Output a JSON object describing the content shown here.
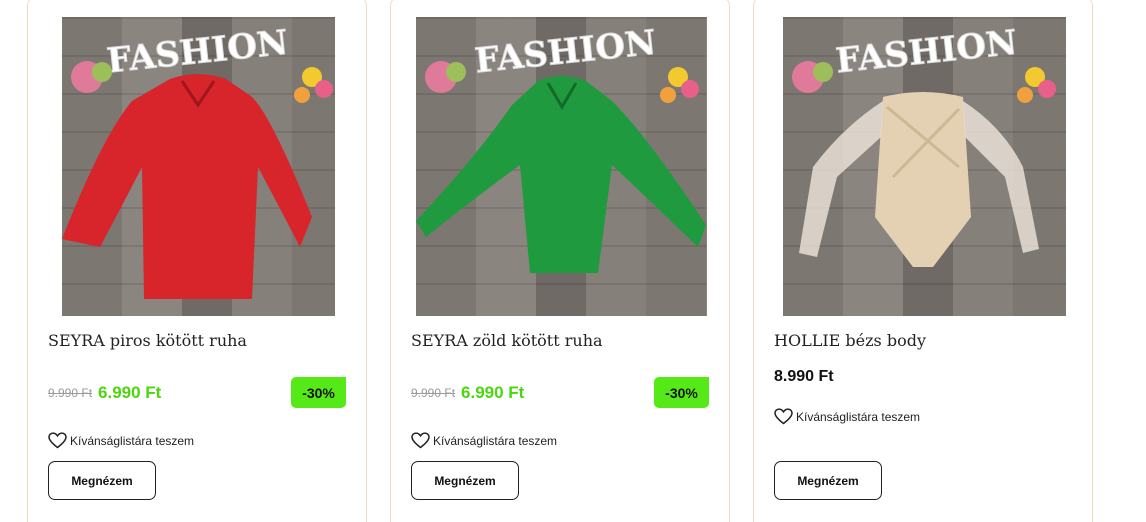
{
  "products": [
    {
      "name": "SEYRA piros kötött ruha",
      "old_price": "9.990 Ft",
      "price": "6.990 Ft",
      "discount": "-30%",
      "wishlist_label": "Kívánságlistára teszem",
      "button_label": "Megnézem",
      "photo_sign": "FASHION",
      "garment_color": "#d8242b"
    },
    {
      "name": "SEYRA zöld kötött ruha",
      "old_price": "9.990 Ft",
      "price": "6.990 Ft",
      "discount": "-30%",
      "wishlist_label": "Kívánságlistára teszem",
      "button_label": "Megnézem",
      "photo_sign": "FASHION",
      "garment_color": "#1f9a3e"
    },
    {
      "name": "HOLLIE bézs body",
      "price": "8.990 Ft",
      "wishlist_label": "Kívánságlistára teszem",
      "button_label": "Megnézem",
      "photo_sign": "FASHION",
      "garment_color": "#e4d1b4"
    }
  ],
  "colors": {
    "accent_green": "#55ea17",
    "sale_price": "#4cd60f",
    "card_border": "#f1dcc0"
  },
  "icons": [
    "heart-icon"
  ]
}
